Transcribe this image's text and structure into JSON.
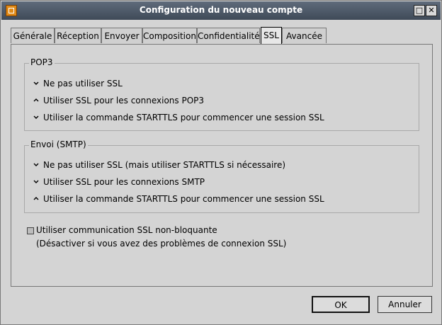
{
  "window": {
    "title": "Configuration du nouveau compte",
    "icon": "app-icon",
    "controls": [
      {
        "name": "maximize-button",
        "glyph": "□"
      },
      {
        "name": "close-button",
        "glyph": "✕"
      }
    ]
  },
  "tabs": [
    {
      "name": "tab-generale",
      "label": "Générale",
      "active": false
    },
    {
      "name": "tab-reception",
      "label": "Réception",
      "active": false
    },
    {
      "name": "tab-envoyer",
      "label": "Envoyer",
      "active": false
    },
    {
      "name": "tab-composition",
      "label": "Composition",
      "active": false
    },
    {
      "name": "tab-confidentialite",
      "label": "Confidentialité",
      "active": false
    },
    {
      "name": "tab-ssl",
      "label": "SSL",
      "active": true
    },
    {
      "name": "tab-avancee",
      "label": "Avancée",
      "active": false
    }
  ],
  "pop3": {
    "legend": "POP3",
    "options": [
      {
        "label": "Ne pas utiliser SSL",
        "selected": false
      },
      {
        "label": "Utiliser SSL pour les connexions POP3",
        "selected": true
      },
      {
        "label": "Utiliser la commande STARTTLS pour commencer une session SSL",
        "selected": false
      }
    ]
  },
  "smtp": {
    "legend": "Envoi (SMTP)",
    "options": [
      {
        "label": "Ne pas utiliser SSL (mais utiliser STARTTLS si nécessaire)",
        "selected": false
      },
      {
        "label": "Utiliser SSL pour les connexions SMTP",
        "selected": false
      },
      {
        "label": "Utiliser la commande STARTTLS pour commencer une session SSL",
        "selected": true
      }
    ]
  },
  "nonblocking": {
    "label": "Utiliser communication SSL non-bloquante",
    "hint": "(Désactiver si vous avez des problèmes de connexion SSL)",
    "checked": false
  },
  "buttons": {
    "ok": "OK",
    "cancel": "Annuler"
  }
}
